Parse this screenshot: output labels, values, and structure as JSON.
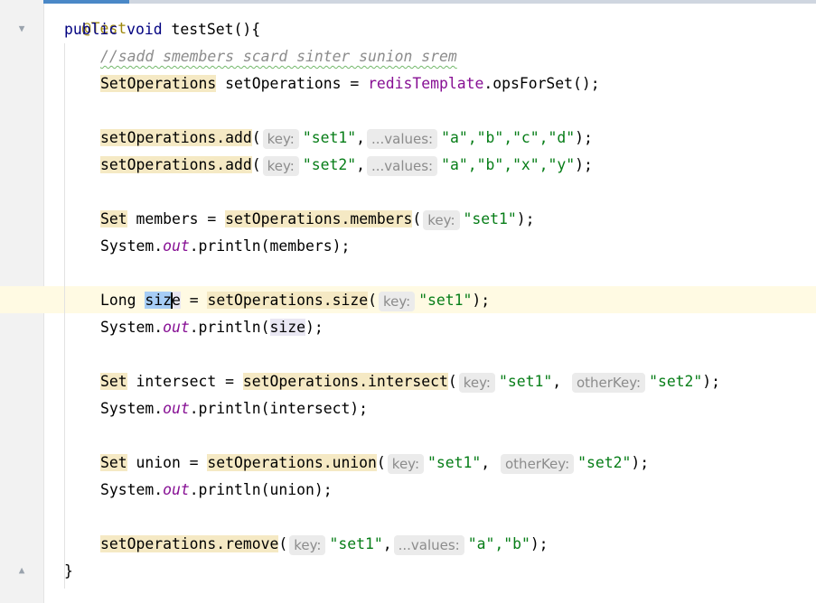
{
  "editor": {
    "annotation": "@Test",
    "kw_public": "public",
    "kw_void": "void",
    "method_name": "testSet",
    "open_sig": "(){",
    "closing_brace": "}"
  },
  "code": {
    "comment": "//sadd smembers scard sinter sunion srem",
    "l1": {
      "type": "SetOperations",
      "rest": " setOperations = ",
      "field": "redisTemplate",
      "call": ".opsForSet();"
    },
    "l2": {
      "call": "setOperations.add",
      "hint_key": "key:",
      "arg1": "\"set1\"",
      "hint_values": "...values:",
      "rest": "\"a\",\"b\",\"c\",\"d\""
    },
    "l3": {
      "call": "setOperations.add",
      "hint_key": "key:",
      "arg1": "\"set2\"",
      "hint_values": "...values:",
      "rest": "\"a\",\"b\",\"x\",\"y\""
    },
    "l4": {
      "type": "Set",
      "rest": " members = ",
      "call": "setOperations.members",
      "hint_key": "key:",
      "arg1": "\"set1\""
    },
    "l5": {
      "prefix": "System.",
      "out": "out",
      "call": ".println(members);"
    },
    "l6": {
      "type": "Long",
      "var_a": "siz",
      "var_b": "e",
      "rest": " = ",
      "call": "setOperations.size",
      "hint_key": "key:",
      "arg1": "\"set1\""
    },
    "l7": {
      "prefix": "System.",
      "out": "out",
      "call": ".println(",
      "var": "size",
      "end": ");"
    },
    "l8": {
      "type": "Set",
      "rest": " intersect = ",
      "call": "setOperations.intersect",
      "hint_key": "key:",
      "arg1": "\"set1\"",
      "hint_other": "otherKey:",
      "arg2": "\"set2\""
    },
    "l9": {
      "prefix": "System.",
      "out": "out",
      "call": ".println(intersect);"
    },
    "l10": {
      "type": "Set",
      "rest": " union = ",
      "call": "setOperations.union",
      "hint_key": "key:",
      "arg1": "\"set1\"",
      "hint_other": "otherKey:",
      "arg2": "\"set2\""
    },
    "l11": {
      "prefix": "System.",
      "out": "out",
      "call": ".println(union);"
    },
    "l12": {
      "call": "setOperations.remove",
      "hint_key": "key:",
      "arg1": "\"set1\"",
      "hint_values": "...values:",
      "rest": "\"a\",\"b\""
    }
  },
  "colors": {
    "keyword": "#000080",
    "string": "#067d17",
    "field": "#871094",
    "comment": "#8c8c8c",
    "highlight": "#f5e9c4",
    "selection": "#a6cdf5",
    "caret_row": "#fffae3"
  }
}
